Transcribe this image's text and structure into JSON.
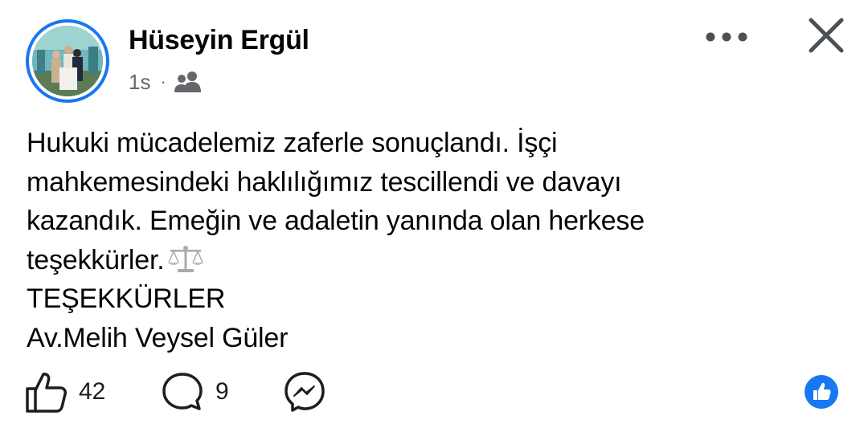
{
  "post": {
    "author": {
      "name": "Hüseyin Ergül"
    },
    "time": "1s",
    "separator": "·",
    "audience_icon": "friends-icon",
    "text": {
      "line1": "Hukuki mücadelemiz zaferle sonuçlandı. İşçi",
      "line2": "mahkemesindeki haklılığımız tescillendi ve davayı",
      "line3": "kazandık. Emeğin ve adaletin yanında olan herkese",
      "line4": "teşekkürler.",
      "line4_emoji": "balance-scale-emoji",
      "line5": "TEŞEKKÜRLER",
      "line6": "Av.Melih Veysel Güler"
    }
  },
  "header": {
    "more_icon": "more-horizontal-icon",
    "close_icon": "close-icon"
  },
  "actions": {
    "like": {
      "icon": "thumbs-up-icon",
      "count": "42"
    },
    "comment": {
      "icon": "comment-bubble-icon",
      "count": "9"
    },
    "share": {
      "icon": "messenger-icon"
    },
    "reaction_badge": {
      "icon": "like-reaction-icon",
      "color": "#1877f2"
    }
  },
  "colors": {
    "accent": "#1877f2",
    "secondary_text": "#65676b",
    "primary_text": "#050505"
  }
}
